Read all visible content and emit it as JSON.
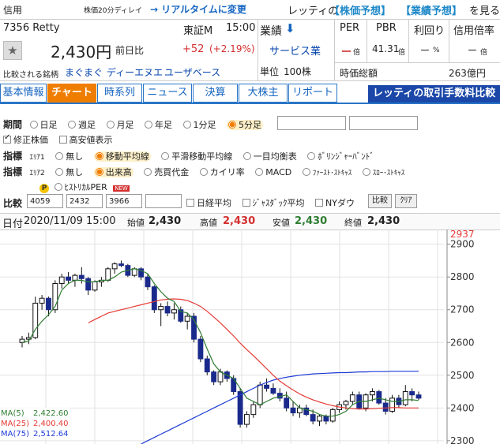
{
  "header": {
    "shinyo": "信用",
    "delay_note": "株価20分ディレイ",
    "realtime_link": "→ リアルタイムに変更",
    "promo_prefix": "レッティの",
    "promo_link1": "【株価予想】",
    "promo_link2": "【業績予想】",
    "promo_suffix": "を見る"
  },
  "stock": {
    "code_name": "7356 Retty",
    "market": "東証M",
    "time": "15:00",
    "price": "2,430円",
    "prev_label": "前日比",
    "change": "+52",
    "change_pct": "(+2.19%)",
    "compare_label": "比較される銘柄",
    "compare1": "まぐまぐ",
    "compare2": "ディーエヌエ",
    "compare3": "ユーザベース"
  },
  "mid": {
    "gyoseki": "業績",
    "sector": "サービス業",
    "unit": "単位",
    "unit_value": "100株"
  },
  "metrics": {
    "per_label": "PER",
    "pbr_label": "PBR",
    "yield_label": "利回り",
    "margin_label": "信用倍率",
    "per_value": "ー",
    "per_unit": "倍",
    "pbr_value": "41.31",
    "pbr_unit": "倍",
    "yield_value": "ー",
    "yield_unit": "%",
    "margin_value": "ー",
    "margin_unit": "倍",
    "mcap_label": "時価総額",
    "mcap_value": "263億円"
  },
  "tabs": [
    "基本情報",
    "チャート",
    "時系列",
    "ニュース",
    "決算",
    "大株主",
    "リポート"
  ],
  "banner": "レッティの取引手数料比較",
  "controls": {
    "period_label": "期間",
    "period_options": [
      "日足",
      "週足",
      "月足",
      "年足",
      "1分足",
      "5分足"
    ],
    "adjusted": "修正株価",
    "highlow": "高安値表示",
    "indicator_label": "指標",
    "area1": "ｴﾘｱ1",
    "area1_options": [
      "無し",
      "移動平均線",
      "平滑移動平均線",
      "一目均衡表",
      "ﾎﾞﾘﾝｼﾞｬｰﾊﾞﾝﾄﾞ"
    ],
    "area2": "ｴﾘｱ2",
    "area2_options": [
      "無し",
      "出来高",
      "売買代金",
      "カイリ率",
      "MACD",
      "ﾌｧｰｽﾄ･ｽﾄｷｬｽ",
      "ｽﾛｰ･ｽﾄｷｬｽ"
    ],
    "historical_per": "ﾋｽﾄﾘｶﾙPER",
    "new_badge": "NEW",
    "compare_label": "比較",
    "compare_inputs": [
      "4059",
      "2432",
      "3966",
      ""
    ],
    "nikkei": "日経平均",
    "jasdaq": "ｼﾞｬｽﾀﾞｯｸ平均",
    "nydow": "NYダウ",
    "compare_btn": "比較",
    "clear_btn": "ｸﾘｱ"
  },
  "ohlc": {
    "date_label": "日付",
    "date": "2020/11/09 15:00",
    "open_label": "始値",
    "open": "2,430",
    "high_label": "高値",
    "high": "2,430",
    "low_label": "安値",
    "low": "2,430",
    "close_label": "終値",
    "close": "2,430"
  },
  "chart_data": {
    "type": "candlestick",
    "y_ticks": [
      2300,
      2400,
      2500,
      2600,
      2700,
      2800,
      2900
    ],
    "y_range": [
      2290,
      2945
    ],
    "max_label": "2937",
    "grid": true,
    "ma_labels": [
      {
        "name": "MA(5)",
        "value": "2,422.60",
        "color": "#2e7d32"
      },
      {
        "name": "MA(25)",
        "value": "2,400.40",
        "color": "#e53935"
      },
      {
        "name": "MA(75)",
        "value": "2,512.64",
        "color": "#1e3bd6"
      }
    ],
    "candles": [
      [
        2600,
        2620,
        2585,
        2610
      ],
      [
        2610,
        2630,
        2595,
        2615
      ],
      [
        2615,
        2740,
        2610,
        2720
      ],
      [
        2720,
        2745,
        2700,
        2735
      ],
      [
        2735,
        2740,
        2680,
        2700
      ],
      [
        2700,
        2790,
        2690,
        2780
      ],
      [
        2780,
        2810,
        2765,
        2800
      ],
      [
        2800,
        2815,
        2780,
        2790
      ],
      [
        2790,
        2810,
        2770,
        2805
      ],
      [
        2805,
        2830,
        2780,
        2795
      ],
      [
        2795,
        2800,
        2745,
        2760
      ],
      [
        2760,
        2790,
        2755,
        2785
      ],
      [
        2785,
        2800,
        2770,
        2790
      ],
      [
        2790,
        2830,
        2785,
        2825
      ],
      [
        2825,
        2845,
        2810,
        2840
      ],
      [
        2840,
        2850,
        2830,
        2835
      ],
      [
        2835,
        2840,
        2800,
        2805
      ],
      [
        2805,
        2830,
        2800,
        2825
      ],
      [
        2825,
        2830,
        2790,
        2800
      ],
      [
        2800,
        2810,
        2760,
        2770
      ],
      [
        2770,
        2775,
        2690,
        2700
      ],
      [
        2700,
        2720,
        2650,
        2710
      ],
      [
        2710,
        2725,
        2680,
        2690
      ],
      [
        2690,
        2720,
        2670,
        2700
      ],
      [
        2700,
        2710,
        2660,
        2665
      ],
      [
        2665,
        2690,
        2640,
        2680
      ],
      [
        2680,
        2690,
        2600,
        2610
      ],
      [
        2610,
        2620,
        2540,
        2550
      ],
      [
        2550,
        2560,
        2500,
        2510
      ],
      [
        2510,
        2515,
        2470,
        2480
      ],
      [
        2480,
        2520,
        2470,
        2510
      ],
      [
        2510,
        2515,
        2480,
        2490
      ],
      [
        2490,
        2500,
        2440,
        2450
      ],
      [
        2450,
        2460,
        2340,
        2350
      ],
      [
        2350,
        2390,
        2340,
        2380
      ],
      [
        2380,
        2420,
        2370,
        2410
      ],
      [
        2410,
        2480,
        2400,
        2470
      ],
      [
        2470,
        2490,
        2450,
        2460
      ],
      [
        2460,
        2475,
        2440,
        2445
      ],
      [
        2445,
        2460,
        2420,
        2430
      ],
      [
        2430,
        2450,
        2390,
        2400
      ],
      [
        2400,
        2420,
        2375,
        2385
      ],
      [
        2385,
        2410,
        2370,
        2400
      ],
      [
        2400,
        2410,
        2375,
        2380
      ],
      [
        2380,
        2395,
        2350,
        2360
      ],
      [
        2360,
        2380,
        2345,
        2375
      ],
      [
        2375,
        2380,
        2350,
        2360
      ],
      [
        2360,
        2400,
        2355,
        2395
      ],
      [
        2395,
        2420,
        2385,
        2410
      ],
      [
        2410,
        2425,
        2395,
        2420
      ],
      [
        2420,
        2450,
        2410,
        2440
      ],
      [
        2440,
        2450,
        2395,
        2400
      ],
      [
        2400,
        2445,
        2390,
        2440
      ],
      [
        2440,
        2460,
        2420,
        2450
      ],
      [
        2450,
        2455,
        2410,
        2415
      ],
      [
        2415,
        2430,
        2380,
        2390
      ],
      [
        2390,
        2440,
        2385,
        2430
      ],
      [
        2430,
        2440,
        2400,
        2410
      ],
      [
        2410,
        2470,
        2405,
        2450
      ],
      [
        2450,
        2460,
        2420,
        2440
      ],
      [
        2440,
        2450,
        2425,
        2430
      ]
    ],
    "ma5": [
      2600,
      2605,
      2640,
      2665,
      2685,
      2710,
      2760,
      2780,
      2790,
      2790,
      2785,
      2785,
      2790,
      2790,
      2800,
      2815,
      2820,
      2825,
      2820,
      2810,
      2780,
      2755,
      2735,
      2725,
      2695,
      2690,
      2670,
      2630,
      2580,
      2535,
      2510,
      2500,
      2490,
      2460,
      2430,
      2420,
      2410,
      2420,
      2430,
      2435,
      2440,
      2420,
      2400,
      2395,
      2390,
      2380,
      2375,
      2375,
      2380,
      2390,
      2410,
      2420,
      2420,
      2425,
      2430,
      2425,
      2420,
      2420,
      2425,
      2425,
      2423
    ],
    "ma25": [
      null,
      null,
      null,
      null,
      null,
      null,
      null,
      null,
      null,
      null,
      2660,
      2670,
      2680,
      2690,
      2695,
      2700,
      2705,
      2710,
      2715,
      2720,
      2725,
      2730,
      2732,
      2733,
      2732,
      2728,
      2720,
      2710,
      2695,
      2678,
      2660,
      2640,
      2620,
      2598,
      2578,
      2560,
      2540,
      2520,
      2500,
      2482,
      2468,
      2455,
      2443,
      2433,
      2425,
      2418,
      2412,
      2407,
      2403,
      2400,
      2398,
      2397,
      2397,
      2398,
      2399,
      2400,
      2401,
      2401,
      2400,
      2400,
      2400
    ],
    "ma75": [
      null,
      null,
      null,
      null,
      null,
      null,
      null,
      null,
      null,
      null,
      null,
      null,
      null,
      null,
      null,
      null,
      null,
      null,
      2290,
      2300,
      2310,
      2320,
      2330,
      2340,
      2350,
      2360,
      2370,
      2380,
      2390,
      2400,
      2410,
      2420,
      2430,
      2440,
      2450,
      2460,
      2470,
      2478,
      2485,
      2490,
      2494,
      2497,
      2500,
      2502,
      2504,
      2505,
      2506,
      2507,
      2508,
      2508,
      2509,
      2510,
      2510,
      2511,
      2511,
      2511,
      2512,
      2512,
      2512,
      2512,
      2512
    ]
  }
}
